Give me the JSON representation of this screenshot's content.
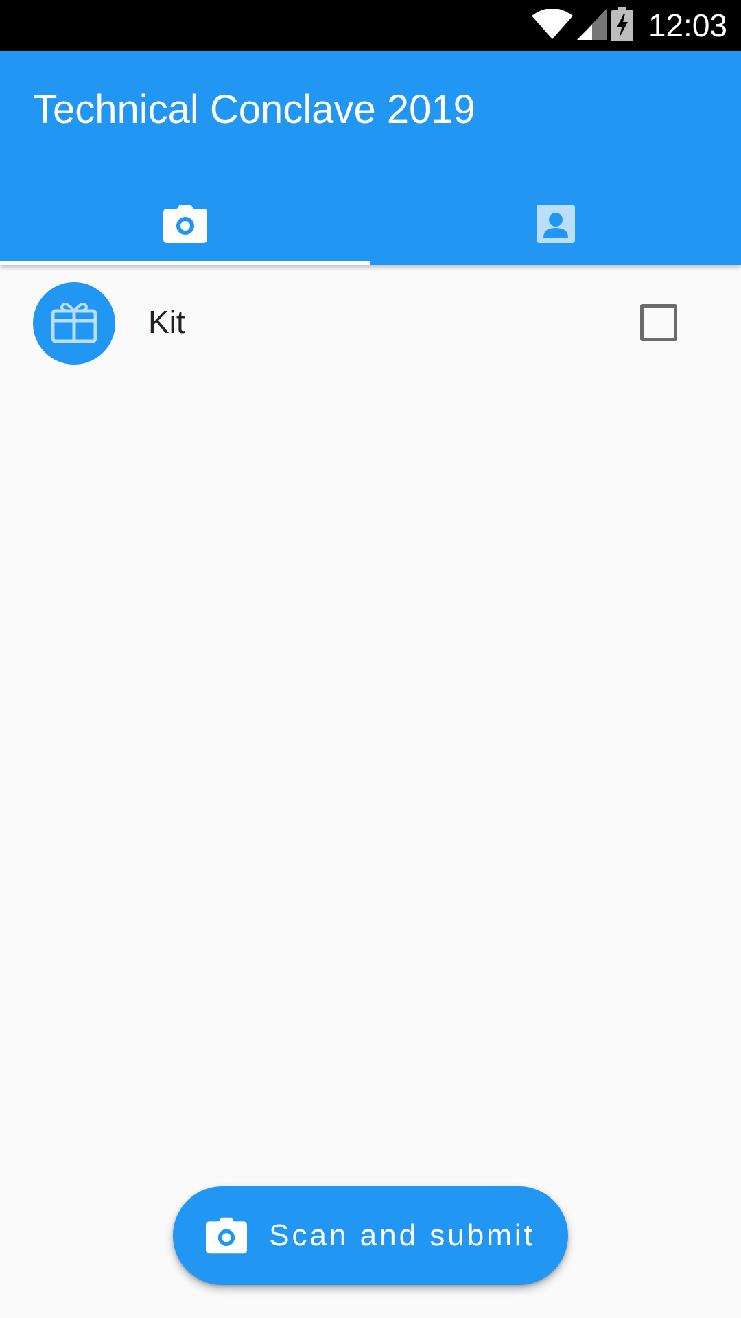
{
  "status_bar": {
    "time": "12:03",
    "icons": [
      "wifi-icon",
      "cell-signal-icon",
      "battery-charging-icon"
    ]
  },
  "app_bar": {
    "title": "Technical Conclave 2019",
    "color": "#2196f3"
  },
  "tabs": [
    {
      "icon": "camera-icon",
      "selected": true
    },
    {
      "icon": "contact-icon",
      "selected": false
    }
  ],
  "list": {
    "items": [
      {
        "icon": "gift-icon",
        "label": "Kit",
        "checked": false
      }
    ]
  },
  "fab": {
    "icon": "camera-icon",
    "label": "Scan and submit"
  }
}
